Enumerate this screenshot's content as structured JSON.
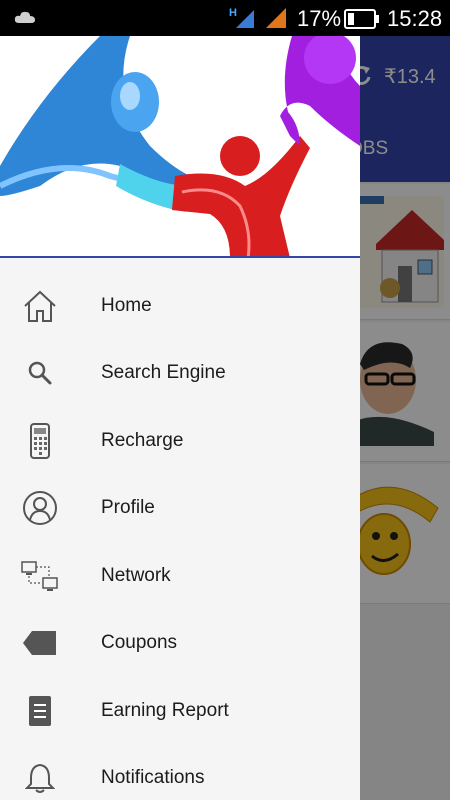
{
  "status_bar": {
    "battery_percent": "17%",
    "time": "15:28",
    "icons": [
      "cloud-icon",
      "signal-h-icon",
      "signal-icon",
      "battery-icon"
    ]
  },
  "background_app": {
    "balance": "₹13.4",
    "tab_label": "OBS",
    "colors": {
      "appbar": "#3344aa"
    }
  },
  "drawer": {
    "menu": [
      {
        "label": "Home",
        "icon": "home-icon"
      },
      {
        "label": "Search Engine",
        "icon": "search-icon"
      },
      {
        "label": "Recharge",
        "icon": "phone-icon"
      },
      {
        "label": "Profile",
        "icon": "profile-icon"
      },
      {
        "label": "Network",
        "icon": "network-icon"
      },
      {
        "label": "Coupons",
        "icon": "tag-icon"
      },
      {
        "label": "Earning Report",
        "icon": "report-icon"
      },
      {
        "label": "Notifications",
        "icon": "bell-icon"
      }
    ]
  }
}
